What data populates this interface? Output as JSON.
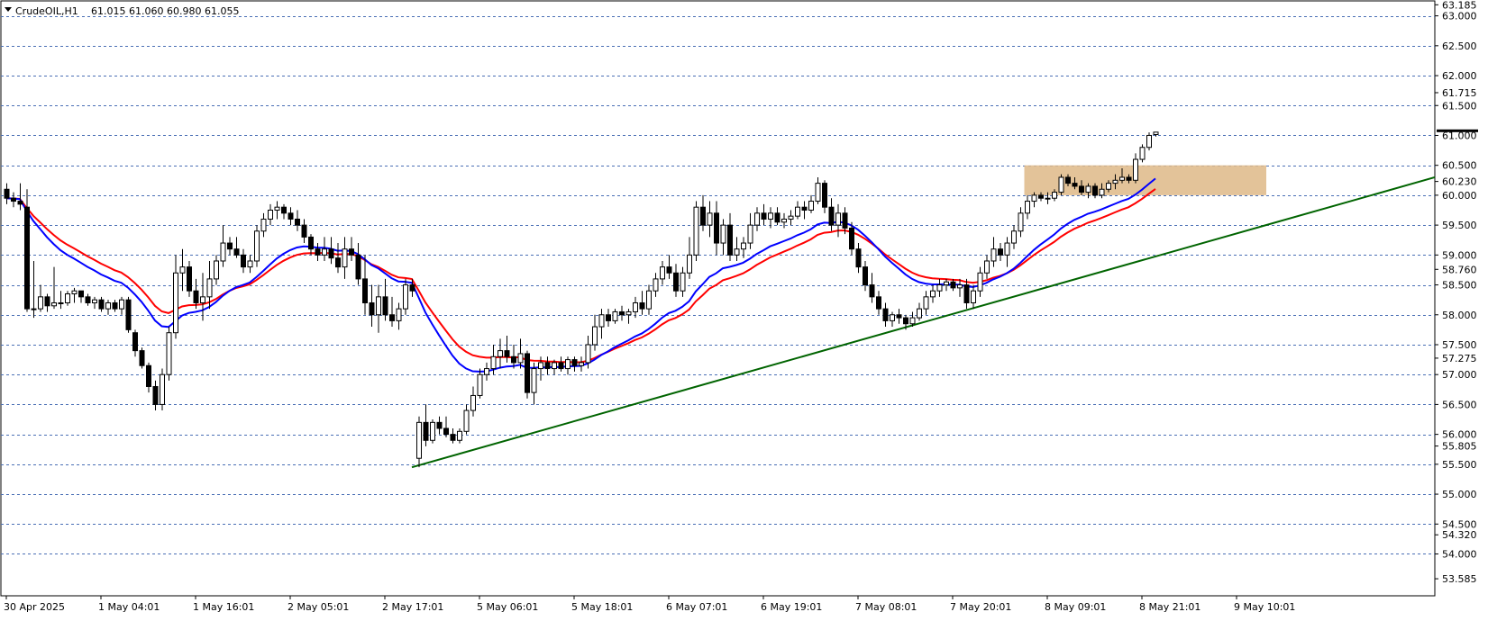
{
  "header": {
    "symbol": "CrudeOIL,H1",
    "ohlc": "61.015 61.060 60.980 61.055"
  },
  "colors": {
    "background": "#ffffff",
    "grid": "#4a6fb5",
    "bull_body": "#ffffff",
    "bear_body": "#000000",
    "candle_outline": "#000000",
    "ema_fast": "#0000ff",
    "ema_slow": "#ff0000",
    "trendline": "#006400",
    "zone": "#deb887",
    "price_tag": "#000000"
  },
  "chart_data": {
    "type": "candlestick",
    "timeframe": "H1",
    "ylim": [
      53.3,
      63.25
    ],
    "grid": true,
    "y_ticks": [
      63.185,
      63.0,
      62.5,
      62.0,
      61.715,
      61.5,
      61.0,
      60.5,
      60.23,
      60.0,
      59.5,
      59.0,
      58.76,
      58.5,
      58.0,
      57.5,
      57.275,
      57.0,
      56.5,
      56.0,
      55.805,
      55.5,
      55.0,
      54.5,
      54.32,
      54.0,
      53.585
    ],
    "y_tick_labels": [
      "63.185",
      "63.000",
      "62.500",
      "62.000",
      "61.715",
      "61.500",
      "61.000",
      "60.500",
      "60.230",
      "60.000",
      "59.500",
      "59.000",
      "58.760",
      "58.500",
      "58.000",
      "57.500",
      "57.275",
      "57.000",
      "56.500",
      "56.000",
      "55.805",
      "55.500",
      "55.000",
      "54.500",
      "54.320",
      "54.000",
      "53.585"
    ],
    "grid_levels": [
      63.0,
      62.5,
      62.0,
      61.5,
      61.0,
      60.5,
      60.0,
      59.5,
      59.0,
      58.5,
      58.0,
      57.5,
      57.0,
      56.5,
      56.0,
      55.5,
      55.0,
      54.5,
      54.0
    ],
    "x_labels": [
      "30 Apr 2025",
      "1 May 04:01",
      "1 May 16:01",
      "2 May 05:01",
      "2 May 17:01",
      "5 May 06:01",
      "5 May 18:01",
      "6 May 07:01",
      "6 May 19:01",
      "7 May 08:01",
      "7 May 20:01",
      "8 May 09:01",
      "8 May 21:01",
      "9 May 10:01"
    ],
    "x_label_bars": [
      0,
      14,
      28,
      42,
      56,
      70,
      84,
      98,
      112,
      126,
      140,
      154,
      168,
      182
    ],
    "current_price": 61.055,
    "candles": [
      {
        "o": 60.1,
        "h": 60.2,
        "l": 59.85,
        "c": 59.95
      },
      {
        "o": 59.95,
        "h": 60.05,
        "l": 59.8,
        "c": 59.9
      },
      {
        "o": 59.9,
        "h": 60.2,
        "l": 59.75,
        "c": 59.85
      },
      {
        "o": 59.8,
        "h": 60.1,
        "l": 58.05,
        "c": 58.1
      },
      {
        "o": 58.1,
        "h": 58.9,
        "l": 57.95,
        "c": 58.1
      },
      {
        "o": 58.1,
        "h": 58.5,
        "l": 58.05,
        "c": 58.3
      },
      {
        "o": 58.3,
        "h": 58.35,
        "l": 58.05,
        "c": 58.15
      },
      {
        "o": 58.15,
        "h": 58.8,
        "l": 58.1,
        "c": 58.2
      },
      {
        "o": 58.2,
        "h": 58.4,
        "l": 58.1,
        "c": 58.2
      },
      {
        "o": 58.2,
        "h": 58.4,
        "l": 58.15,
        "c": 58.35
      },
      {
        "o": 58.35,
        "h": 58.45,
        "l": 58.2,
        "c": 58.4
      },
      {
        "o": 58.4,
        "h": 58.4,
        "l": 58.2,
        "c": 58.3
      },
      {
        "o": 58.3,
        "h": 58.35,
        "l": 58.15,
        "c": 58.2
      },
      {
        "o": 58.2,
        "h": 58.3,
        "l": 58.1,
        "c": 58.25
      },
      {
        "o": 58.25,
        "h": 58.3,
        "l": 58.05,
        "c": 58.1
      },
      {
        "o": 58.1,
        "h": 58.25,
        "l": 58.0,
        "c": 58.2
      },
      {
        "o": 58.2,
        "h": 58.25,
        "l": 58.05,
        "c": 58.1
      },
      {
        "o": 58.1,
        "h": 58.3,
        "l": 58.0,
        "c": 58.25
      },
      {
        "o": 58.25,
        "h": 58.3,
        "l": 57.7,
        "c": 57.75
      },
      {
        "o": 57.7,
        "h": 57.75,
        "l": 57.3,
        "c": 57.4
      },
      {
        "o": 57.4,
        "h": 57.45,
        "l": 57.1,
        "c": 57.15
      },
      {
        "o": 57.15,
        "h": 57.2,
        "l": 56.7,
        "c": 56.8
      },
      {
        "o": 56.8,
        "h": 56.9,
        "l": 56.4,
        "c": 56.5
      },
      {
        "o": 56.5,
        "h": 57.1,
        "l": 56.4,
        "c": 57.0
      },
      {
        "o": 57.0,
        "h": 57.8,
        "l": 56.9,
        "c": 57.7
      },
      {
        "o": 57.7,
        "h": 59.0,
        "l": 57.6,
        "c": 58.7
      },
      {
        "o": 58.7,
        "h": 59.1,
        "l": 58.4,
        "c": 58.8
      },
      {
        "o": 58.8,
        "h": 58.9,
        "l": 58.3,
        "c": 58.4
      },
      {
        "o": 58.4,
        "h": 58.6,
        "l": 58.1,
        "c": 58.2
      },
      {
        "o": 58.2,
        "h": 58.7,
        "l": 57.9,
        "c": 58.3
      },
      {
        "o": 58.3,
        "h": 58.9,
        "l": 58.1,
        "c": 58.6
      },
      {
        "o": 58.6,
        "h": 59.0,
        "l": 58.5,
        "c": 58.9
      },
      {
        "o": 58.9,
        "h": 59.5,
        "l": 58.8,
        "c": 59.2
      },
      {
        "o": 59.2,
        "h": 59.3,
        "l": 59.0,
        "c": 59.1
      },
      {
        "o": 59.1,
        "h": 59.3,
        "l": 58.95,
        "c": 59.0
      },
      {
        "o": 59.0,
        "h": 59.1,
        "l": 58.7,
        "c": 58.8
      },
      {
        "o": 58.8,
        "h": 59.0,
        "l": 58.7,
        "c": 58.9
      },
      {
        "o": 58.9,
        "h": 59.5,
        "l": 58.8,
        "c": 59.4
      },
      {
        "o": 59.4,
        "h": 59.7,
        "l": 59.3,
        "c": 59.6
      },
      {
        "o": 59.6,
        "h": 59.85,
        "l": 59.5,
        "c": 59.75
      },
      {
        "o": 59.75,
        "h": 59.9,
        "l": 59.6,
        "c": 59.8
      },
      {
        "o": 59.8,
        "h": 59.85,
        "l": 59.6,
        "c": 59.7
      },
      {
        "o": 59.7,
        "h": 59.8,
        "l": 59.5,
        "c": 59.6
      },
      {
        "o": 59.6,
        "h": 59.75,
        "l": 59.4,
        "c": 59.5
      },
      {
        "o": 59.5,
        "h": 59.6,
        "l": 59.2,
        "c": 59.3
      },
      {
        "o": 59.3,
        "h": 59.35,
        "l": 59.0,
        "c": 59.1
      },
      {
        "o": 59.1,
        "h": 59.2,
        "l": 58.9,
        "c": 59.0
      },
      {
        "o": 59.0,
        "h": 59.3,
        "l": 58.9,
        "c": 59.1
      },
      {
        "o": 59.1,
        "h": 59.3,
        "l": 58.85,
        "c": 58.95
      },
      {
        "o": 58.95,
        "h": 59.2,
        "l": 58.7,
        "c": 58.8
      },
      {
        "o": 58.8,
        "h": 59.3,
        "l": 58.6,
        "c": 59.1
      },
      {
        "o": 59.1,
        "h": 59.3,
        "l": 58.9,
        "c": 59.0
      },
      {
        "o": 59.0,
        "h": 59.2,
        "l": 58.5,
        "c": 58.6
      },
      {
        "o": 58.6,
        "h": 59.0,
        "l": 58.0,
        "c": 58.2
      },
      {
        "o": 58.2,
        "h": 58.5,
        "l": 57.8,
        "c": 58.0
      },
      {
        "o": 58.0,
        "h": 58.5,
        "l": 57.7,
        "c": 58.3
      },
      {
        "o": 58.3,
        "h": 58.6,
        "l": 57.9,
        "c": 58.0
      },
      {
        "o": 58.0,
        "h": 58.3,
        "l": 57.8,
        "c": 57.9
      },
      {
        "o": 57.9,
        "h": 58.2,
        "l": 57.75,
        "c": 58.1
      },
      {
        "o": 58.1,
        "h": 58.6,
        "l": 58.0,
        "c": 58.5
      },
      {
        "o": 58.5,
        "h": 58.6,
        "l": 58.3,
        "c": 58.4
      },
      {
        "o": 55.6,
        "h": 56.3,
        "l": 55.45,
        "c": 56.2
      },
      {
        "o": 56.2,
        "h": 56.5,
        "l": 55.8,
        "c": 55.9
      },
      {
        "o": 55.9,
        "h": 56.25,
        "l": 55.85,
        "c": 56.2
      },
      {
        "o": 56.2,
        "h": 56.3,
        "l": 56.0,
        "c": 56.1
      },
      {
        "o": 56.1,
        "h": 56.3,
        "l": 55.95,
        "c": 56.0
      },
      {
        "o": 56.0,
        "h": 56.1,
        "l": 55.85,
        "c": 55.9
      },
      {
        "o": 55.9,
        "h": 56.1,
        "l": 55.85,
        "c": 56.05
      },
      {
        "o": 56.05,
        "h": 56.5,
        "l": 56.0,
        "c": 56.4
      },
      {
        "o": 56.4,
        "h": 56.8,
        "l": 56.3,
        "c": 56.65
      },
      {
        "o": 56.65,
        "h": 57.1,
        "l": 56.6,
        "c": 57.0
      },
      {
        "o": 57.0,
        "h": 57.2,
        "l": 56.9,
        "c": 57.1
      },
      {
        "o": 57.1,
        "h": 57.5,
        "l": 57.0,
        "c": 57.3
      },
      {
        "o": 57.3,
        "h": 57.6,
        "l": 57.1,
        "c": 57.4
      },
      {
        "o": 57.4,
        "h": 57.65,
        "l": 57.2,
        "c": 57.3
      },
      {
        "o": 57.3,
        "h": 57.5,
        "l": 57.1,
        "c": 57.2
      },
      {
        "o": 57.2,
        "h": 57.6,
        "l": 57.1,
        "c": 57.35
      },
      {
        "o": 57.35,
        "h": 57.4,
        "l": 56.6,
        "c": 56.7
      },
      {
        "o": 56.7,
        "h": 57.2,
        "l": 56.5,
        "c": 57.1
      },
      {
        "o": 57.1,
        "h": 57.3,
        "l": 56.9,
        "c": 57.2
      },
      {
        "o": 57.2,
        "h": 57.3,
        "l": 57.0,
        "c": 57.1
      },
      {
        "o": 57.1,
        "h": 57.25,
        "l": 57.0,
        "c": 57.2
      },
      {
        "o": 57.2,
        "h": 57.3,
        "l": 57.05,
        "c": 57.1
      },
      {
        "o": 57.1,
        "h": 57.3,
        "l": 57.0,
        "c": 57.25
      },
      {
        "o": 57.25,
        "h": 57.3,
        "l": 57.05,
        "c": 57.15
      },
      {
        "o": 57.15,
        "h": 57.3,
        "l": 57.05,
        "c": 57.2
      },
      {
        "o": 57.2,
        "h": 57.65,
        "l": 57.1,
        "c": 57.5
      },
      {
        "o": 57.5,
        "h": 58.0,
        "l": 57.4,
        "c": 57.8
      },
      {
        "o": 57.8,
        "h": 58.1,
        "l": 57.6,
        "c": 58.0
      },
      {
        "o": 58.0,
        "h": 58.1,
        "l": 57.8,
        "c": 57.9
      },
      {
        "o": 57.9,
        "h": 58.1,
        "l": 57.85,
        "c": 58.05
      },
      {
        "o": 58.05,
        "h": 58.15,
        "l": 57.9,
        "c": 58.0
      },
      {
        "o": 58.0,
        "h": 58.1,
        "l": 57.85,
        "c": 58.05
      },
      {
        "o": 58.05,
        "h": 58.3,
        "l": 57.95,
        "c": 58.2
      },
      {
        "o": 58.2,
        "h": 58.4,
        "l": 58.0,
        "c": 58.1
      },
      {
        "o": 58.1,
        "h": 58.5,
        "l": 58.0,
        "c": 58.4
      },
      {
        "o": 58.4,
        "h": 58.7,
        "l": 58.3,
        "c": 58.6
      },
      {
        "o": 58.6,
        "h": 58.9,
        "l": 58.5,
        "c": 58.8
      },
      {
        "o": 58.8,
        "h": 59.0,
        "l": 58.6,
        "c": 58.7
      },
      {
        "o": 58.7,
        "h": 58.85,
        "l": 58.3,
        "c": 58.4
      },
      {
        "o": 58.4,
        "h": 58.8,
        "l": 58.3,
        "c": 58.7
      },
      {
        "o": 58.7,
        "h": 59.3,
        "l": 58.6,
        "c": 59.0
      },
      {
        "o": 59.0,
        "h": 59.9,
        "l": 58.9,
        "c": 59.8
      },
      {
        "o": 59.8,
        "h": 60.0,
        "l": 59.4,
        "c": 59.5
      },
      {
        "o": 59.5,
        "h": 59.9,
        "l": 59.3,
        "c": 59.7
      },
      {
        "o": 59.7,
        "h": 59.9,
        "l": 59.0,
        "c": 59.2
      },
      {
        "o": 59.2,
        "h": 59.6,
        "l": 59.0,
        "c": 59.5
      },
      {
        "o": 59.5,
        "h": 59.7,
        "l": 58.9,
        "c": 59.0
      },
      {
        "o": 59.0,
        "h": 59.3,
        "l": 58.9,
        "c": 59.1
      },
      {
        "o": 59.1,
        "h": 59.3,
        "l": 58.95,
        "c": 59.2
      },
      {
        "o": 59.2,
        "h": 59.7,
        "l": 59.1,
        "c": 59.5
      },
      {
        "o": 59.5,
        "h": 59.8,
        "l": 59.4,
        "c": 59.7
      },
      {
        "o": 59.7,
        "h": 59.85,
        "l": 59.5,
        "c": 59.6
      },
      {
        "o": 59.6,
        "h": 59.8,
        "l": 59.45,
        "c": 59.7
      },
      {
        "o": 59.7,
        "h": 59.8,
        "l": 59.5,
        "c": 59.55
      },
      {
        "o": 59.55,
        "h": 59.7,
        "l": 59.45,
        "c": 59.6
      },
      {
        "o": 59.6,
        "h": 59.75,
        "l": 59.5,
        "c": 59.65
      },
      {
        "o": 59.65,
        "h": 59.9,
        "l": 59.6,
        "c": 59.8
      },
      {
        "o": 59.8,
        "h": 59.9,
        "l": 59.6,
        "c": 59.75
      },
      {
        "o": 59.75,
        "h": 60.0,
        "l": 59.7,
        "c": 59.9
      },
      {
        "o": 59.9,
        "h": 60.3,
        "l": 59.85,
        "c": 60.2
      },
      {
        "o": 60.2,
        "h": 60.25,
        "l": 59.7,
        "c": 59.8
      },
      {
        "o": 59.8,
        "h": 59.95,
        "l": 59.4,
        "c": 59.5
      },
      {
        "o": 59.5,
        "h": 59.85,
        "l": 59.3,
        "c": 59.7
      },
      {
        "o": 59.7,
        "h": 59.8,
        "l": 59.35,
        "c": 59.45
      },
      {
        "o": 59.45,
        "h": 59.55,
        "l": 59.0,
        "c": 59.1
      },
      {
        "o": 59.1,
        "h": 59.2,
        "l": 58.7,
        "c": 58.8
      },
      {
        "o": 58.8,
        "h": 58.9,
        "l": 58.4,
        "c": 58.5
      },
      {
        "o": 58.5,
        "h": 58.7,
        "l": 58.2,
        "c": 58.3
      },
      {
        "o": 58.3,
        "h": 58.4,
        "l": 58.0,
        "c": 58.1
      },
      {
        "o": 58.1,
        "h": 58.2,
        "l": 57.8,
        "c": 57.9
      },
      {
        "o": 57.9,
        "h": 58.05,
        "l": 57.8,
        "c": 58.0
      },
      {
        "o": 58.0,
        "h": 58.1,
        "l": 57.85,
        "c": 57.95
      },
      {
        "o": 57.95,
        "h": 58.0,
        "l": 57.75,
        "c": 57.85
      },
      {
        "o": 57.85,
        "h": 58.05,
        "l": 57.8,
        "c": 57.95
      },
      {
        "o": 57.95,
        "h": 58.2,
        "l": 57.9,
        "c": 58.1
      },
      {
        "o": 58.1,
        "h": 58.4,
        "l": 58.0,
        "c": 58.3
      },
      {
        "o": 58.3,
        "h": 58.5,
        "l": 58.2,
        "c": 58.4
      },
      {
        "o": 58.4,
        "h": 58.6,
        "l": 58.3,
        "c": 58.5
      },
      {
        "o": 58.5,
        "h": 58.6,
        "l": 58.4,
        "c": 58.55
      },
      {
        "o": 58.55,
        "h": 58.6,
        "l": 58.4,
        "c": 58.45
      },
      {
        "o": 58.45,
        "h": 58.6,
        "l": 58.3,
        "c": 58.5
      },
      {
        "o": 58.5,
        "h": 58.6,
        "l": 58.1,
        "c": 58.2
      },
      {
        "o": 58.2,
        "h": 58.5,
        "l": 58.1,
        "c": 58.4
      },
      {
        "o": 58.4,
        "h": 58.8,
        "l": 58.3,
        "c": 58.7
      },
      {
        "o": 58.7,
        "h": 59.0,
        "l": 58.6,
        "c": 58.9
      },
      {
        "o": 58.9,
        "h": 59.3,
        "l": 58.8,
        "c": 59.1
      },
      {
        "o": 59.1,
        "h": 59.2,
        "l": 58.9,
        "c": 59.0
      },
      {
        "o": 59.0,
        "h": 59.3,
        "l": 58.8,
        "c": 59.2
      },
      {
        "o": 59.2,
        "h": 59.5,
        "l": 59.1,
        "c": 59.4
      },
      {
        "o": 59.4,
        "h": 59.8,
        "l": 59.3,
        "c": 59.7
      },
      {
        "o": 59.7,
        "h": 60.0,
        "l": 59.6,
        "c": 59.9
      },
      {
        "o": 59.9,
        "h": 60.05,
        "l": 59.8,
        "c": 60.0
      },
      {
        "o": 60.0,
        "h": 60.05,
        "l": 59.9,
        "c": 59.95
      },
      {
        "o": 59.95,
        "h": 60.05,
        "l": 59.85,
        "c": 59.95
      },
      {
        "o": 59.95,
        "h": 60.1,
        "l": 59.9,
        "c": 60.05
      },
      {
        "o": 60.05,
        "h": 60.35,
        "l": 60.0,
        "c": 60.3
      },
      {
        "o": 60.3,
        "h": 60.35,
        "l": 60.15,
        "c": 60.2
      },
      {
        "o": 60.2,
        "h": 60.3,
        "l": 60.1,
        "c": 60.15
      },
      {
        "o": 60.15,
        "h": 60.25,
        "l": 60.0,
        "c": 60.05
      },
      {
        "o": 60.05,
        "h": 60.2,
        "l": 59.95,
        "c": 60.15
      },
      {
        "o": 60.15,
        "h": 60.2,
        "l": 59.95,
        "c": 60.0
      },
      {
        "o": 60.0,
        "h": 60.2,
        "l": 59.95,
        "c": 60.1
      },
      {
        "o": 60.1,
        "h": 60.25,
        "l": 60.05,
        "c": 60.2
      },
      {
        "o": 60.2,
        "h": 60.35,
        "l": 60.1,
        "c": 60.25
      },
      {
        "o": 60.25,
        "h": 60.45,
        "l": 60.2,
        "c": 60.3
      },
      {
        "o": 60.3,
        "h": 60.35,
        "l": 60.2,
        "c": 60.25
      },
      {
        "o": 60.25,
        "h": 60.7,
        "l": 60.2,
        "c": 60.6
      },
      {
        "o": 60.6,
        "h": 60.85,
        "l": 60.55,
        "c": 60.8
      },
      {
        "o": 60.8,
        "h": 61.05,
        "l": 60.75,
        "c": 61.0
      },
      {
        "o": 61.015,
        "h": 61.06,
        "l": 60.98,
        "c": 61.055
      }
    ]
  }
}
